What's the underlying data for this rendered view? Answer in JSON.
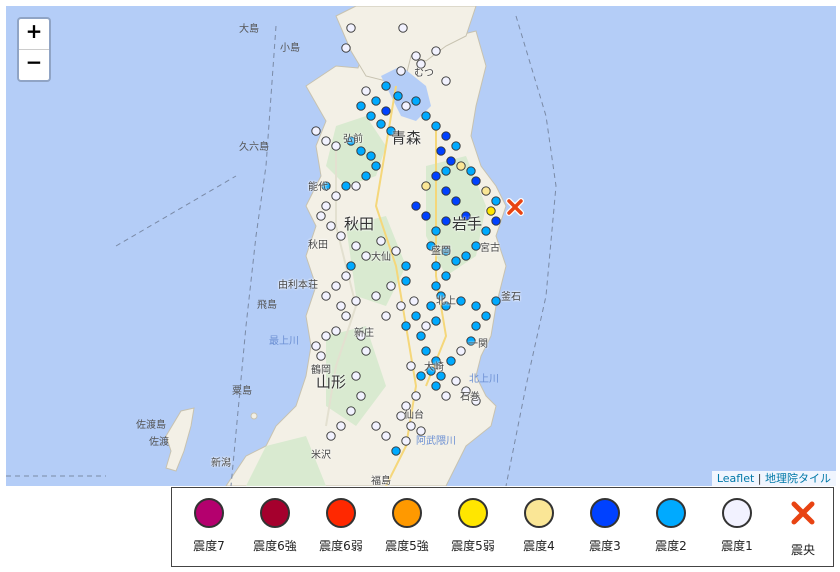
{
  "zoom": {
    "in_label": "+",
    "out_label": "−"
  },
  "attribution": {
    "leaflet": "Leaflet",
    "separator": " | ",
    "tiles": "地理院タイル"
  },
  "prefectures": [
    "青森",
    "秋田",
    "岩手",
    "山形"
  ],
  "cities": [
    "むつ",
    "弘前",
    "能代",
    "秋田",
    "由利本荘",
    "盛岡",
    "宮古",
    "釜石",
    "大仙",
    "北上",
    "一関",
    "鶴岡",
    "新庄",
    "大崎",
    "石巻",
    "仙台",
    "米沢",
    "福島",
    "新潟"
  ],
  "islands": [
    "大島",
    "小島",
    "久六島",
    "飛島",
    "粟島",
    "佐渡島",
    "佐渡"
  ],
  "rivers": [
    "最上川",
    "北上川",
    "阿武隈川"
  ],
  "epicenter": {
    "label": "震央"
  },
  "legend": [
    {
      "label": "震度7",
      "color": "#b4006e"
    },
    {
      "label": "震度6強",
      "color": "#a5002d"
    },
    {
      "label": "震度6弱",
      "color": "#ff2800"
    },
    {
      "label": "震度5強",
      "color": "#ff9900"
    },
    {
      "label": "震度5弱",
      "color": "#ffe600"
    },
    {
      "label": "震度4",
      "color": "#fae696"
    },
    {
      "label": "震度3",
      "color": "#0041ff"
    },
    {
      "label": "震度2",
      "color": "#00aaff"
    },
    {
      "label": "震度1",
      "color": "#f2f2ff"
    },
    {
      "label": "震央",
      "color": "#e84312",
      "icon": "cross-icon"
    }
  ]
}
